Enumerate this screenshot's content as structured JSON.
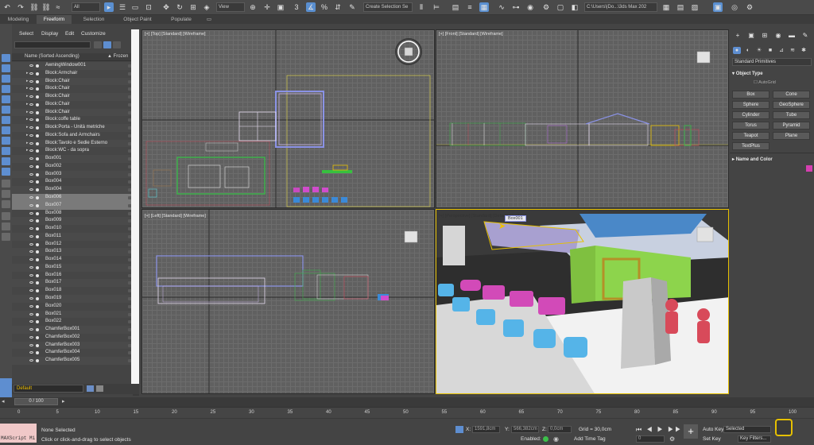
{
  "toolbar": {
    "selection_filter": "All",
    "reference_coord": "View",
    "create_selection_set": "Create Selection Se",
    "project_path": "C:\\Users\\|Do...\\3ds Max 202"
  },
  "ribbon": {
    "tabs": [
      {
        "label": "Modeling"
      },
      {
        "label": "Freeform"
      },
      {
        "label": "Selection"
      },
      {
        "label": "Object Paint"
      },
      {
        "label": "Populate"
      }
    ]
  },
  "scene_explorer": {
    "menu": [
      "Select",
      "Display",
      "Edit",
      "Customize"
    ],
    "header_name": "Name (Sorted Ascending)",
    "header_frozen": "▲ Frozen",
    "items": [
      {
        "name": "AwningWindow001",
        "expand": false,
        "selected": false
      },
      {
        "name": "Block:Armchair",
        "expand": true,
        "selected": false
      },
      {
        "name": "Block:Chair",
        "expand": true,
        "selected": false
      },
      {
        "name": "Block:Chair",
        "expand": true,
        "selected": false
      },
      {
        "name": "Block:Chair",
        "expand": true,
        "selected": false
      },
      {
        "name": "Block:Chair",
        "expand": true,
        "selected": false
      },
      {
        "name": "Block:Chair",
        "expand": true,
        "selected": false
      },
      {
        "name": "Block:coffe table",
        "expand": true,
        "selected": false
      },
      {
        "name": "Block:Porta - Unità metriche",
        "expand": true,
        "selected": false
      },
      {
        "name": "Block:Sofa and Armchairs",
        "expand": true,
        "selected": false
      },
      {
        "name": "Block:Tavolo e Sedie Esterno",
        "expand": true,
        "selected": false
      },
      {
        "name": "Block:WC - da sopra",
        "expand": true,
        "selected": false
      },
      {
        "name": "Box001",
        "expand": false,
        "selected": false
      },
      {
        "name": "Box002",
        "expand": false,
        "selected": false
      },
      {
        "name": "Box003",
        "expand": false,
        "selected": false
      },
      {
        "name": "Box004",
        "expand": false,
        "selected": false
      },
      {
        "name": "Box004",
        "expand": false,
        "selected": false
      },
      {
        "name": "Box006",
        "expand": false,
        "selected": true
      },
      {
        "name": "Box007",
        "expand": false,
        "selected": true
      },
      {
        "name": "Box008",
        "expand": false,
        "selected": false
      },
      {
        "name": "Box009",
        "expand": false,
        "selected": false
      },
      {
        "name": "Box010",
        "expand": false,
        "selected": false
      },
      {
        "name": "Box011",
        "expand": false,
        "selected": false
      },
      {
        "name": "Box012",
        "expand": false,
        "selected": false
      },
      {
        "name": "Box013",
        "expand": false,
        "selected": false
      },
      {
        "name": "Box014",
        "expand": false,
        "selected": false
      },
      {
        "name": "Box015",
        "expand": false,
        "selected": false
      },
      {
        "name": "Box016",
        "expand": false,
        "selected": false
      },
      {
        "name": "Box017",
        "expand": false,
        "selected": false
      },
      {
        "name": "Box018",
        "expand": false,
        "selected": false
      },
      {
        "name": "Box019",
        "expand": false,
        "selected": false
      },
      {
        "name": "Box020",
        "expand": false,
        "selected": false
      },
      {
        "name": "Box021",
        "expand": false,
        "selected": false
      },
      {
        "name": "Box022",
        "expand": false,
        "selected": false
      },
      {
        "name": "ChamferBox001",
        "expand": false,
        "selected": false
      },
      {
        "name": "ChamferBox002",
        "expand": false,
        "selected": false
      },
      {
        "name": "ChamferBox003",
        "expand": false,
        "selected": false
      },
      {
        "name": "ChamferBox004",
        "expand": false,
        "selected": false
      },
      {
        "name": "ChamferBox005",
        "expand": false,
        "selected": false
      }
    ],
    "layer": "Default"
  },
  "viewports": {
    "top": "[+] [Top] [Standard] [Wireframe]",
    "front": "[+] [Front] [Standard] [Wireframe]",
    "left": "[+] [Left] [Standard] [Wireframe]",
    "perspective": "[+] [Perspective] [Standard] [Default Shading]",
    "tooltip": "Box001"
  },
  "command_panel": {
    "dropdown": "Standard Primitives",
    "object_type_title": "Object Type",
    "autogrid": "AutoGrid",
    "buttons": [
      "Box",
      "Cone",
      "Sphere",
      "GeoSphere",
      "Cylinder",
      "Tube",
      "Torus",
      "Pyramid",
      "Teapot",
      "Plane",
      "TextPlus"
    ],
    "name_color_title": "Name and Color"
  },
  "timeline": {
    "frame": "0 / 100",
    "ticks": [
      "0",
      "5",
      "10",
      "15",
      "20",
      "25",
      "30",
      "35",
      "40",
      "45",
      "50",
      "55",
      "60",
      "65",
      "70",
      "75",
      "80",
      "85",
      "90",
      "95",
      "100"
    ]
  },
  "status": {
    "maxscript": "MAXScript Mi",
    "selection": "None Selected",
    "prompt": "Click or click-and-drag to select objects",
    "x_label": "X:",
    "x_value": "1591,8cm",
    "y_label": "Y:",
    "y_value": "566,382cm",
    "z_label": "Z:",
    "z_value": "0,0cm",
    "grid": "Grid = 30,0cm",
    "enabled": "Enabled:",
    "add_time_tag": "Add Time Tag",
    "auto_key": "Auto Key",
    "set_key": "Set Key",
    "key_mode": "Selected",
    "key_filters": "Key Filters...",
    "frame_field": "0"
  }
}
